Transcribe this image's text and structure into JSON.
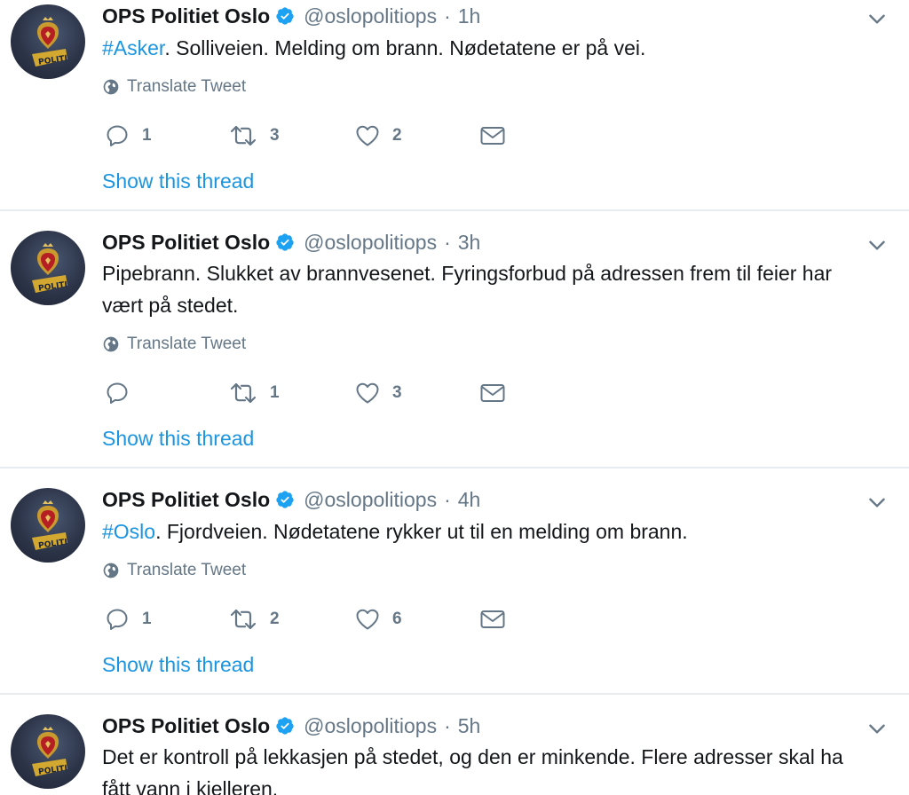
{
  "tweets": [
    {
      "name": "OPS Politiet Oslo",
      "handle": "@oslopolitiops",
      "separator": "·",
      "time": "1h",
      "hashtag": "#Asker",
      "text": ". Solliveien. Melding om brann. Nødetatene er på vei.",
      "text_line2": "",
      "translate": "Translate Tweet",
      "replies": "1",
      "retweets": "3",
      "likes": "2",
      "thread": "Show this thread"
    },
    {
      "name": "OPS Politiet Oslo",
      "handle": "@oslopolitiops",
      "separator": "·",
      "time": "3h",
      "hashtag": "",
      "text": "Pipebrann. Slukket av brannvesenet. Fyringsforbud på adressen frem til feier har",
      "text_line2": "vært på stedet.",
      "translate": "Translate Tweet",
      "replies": "",
      "retweets": "1",
      "likes": "3",
      "thread": "Show this thread"
    },
    {
      "name": "OPS Politiet Oslo",
      "handle": "@oslopolitiops",
      "separator": "·",
      "time": "4h",
      "hashtag": "#Oslo",
      "text": ". Fjordveien. Nødetatene rykker ut til en melding om brann.",
      "text_line2": "",
      "translate": "Translate Tweet",
      "replies": "1",
      "retweets": "2",
      "likes": "6",
      "thread": "Show this thread"
    },
    {
      "name": "OPS Politiet Oslo",
      "handle": "@oslopolitiops",
      "separator": "·",
      "time": "5h",
      "hashtag": "",
      "text": "Det er kontroll på lekkasjen på stedet, og den er minkende. Flere adresser skal ha",
      "text_line2": "fått vann i kjelleren.",
      "translate": "",
      "replies": "",
      "retweets": "",
      "likes": "",
      "thread": ""
    }
  ],
  "colors": {
    "accent": "#1b95e0",
    "secondary_text": "#657786",
    "divider": "#e6ecf0"
  },
  "icons": [
    "avatar-police-badge",
    "verified-icon",
    "chevron-down-icon",
    "globe-icon",
    "reply-icon",
    "retweet-icon",
    "heart-icon",
    "envelope-icon"
  ]
}
